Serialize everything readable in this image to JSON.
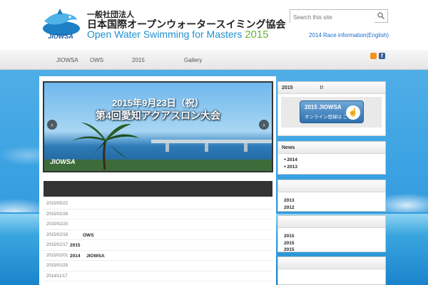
{
  "header": {
    "org_small": "一般社団法人",
    "org_title": "日本国際オープンウォータースイミング協会",
    "org_sub": "Open Water Swimming for Masters",
    "org_year": "2015",
    "logo_text": "JIOWSA"
  },
  "search": {
    "placeholder": "Search this site"
  },
  "race_link": "2014 Race information(English)",
  "nav": {
    "items": [
      "JIOWSA",
      "OWS",
      "2015",
      "Gallery"
    ]
  },
  "slider": {
    "date": "2015年9月23日（祝）",
    "title": "第4回愛知アクアスロン大会",
    "logo": "JIOWSA"
  },
  "news_list": [
    {
      "date": "2015/05/22",
      "tag": ""
    },
    {
      "date": "2015/02/28",
      "tag": ""
    },
    {
      "date": "2015/02/20",
      "tag": ""
    },
    {
      "date": "2015/02/18",
      "tag": "OWS"
    },
    {
      "date": "2015/02/17",
      "tag": "2015"
    },
    {
      "date": "2015/02/01",
      "tag": "2014",
      "tag2": "JIOWSA"
    },
    {
      "date": "2015/01/29",
      "tag": ""
    },
    {
      "date": "2014/11/17",
      "tag": ""
    }
  ],
  "sidebar": {
    "widget1_title": "2015",
    "widget1_title_suffix": "!!",
    "register_line1": "2015 JIOWSA",
    "register_line2": "オンライン登録は こちら",
    "widget2_title": "News",
    "widget2_items": [
      "2014",
      "2013"
    ],
    "widget3_items": [
      "2013",
      "2012"
    ],
    "widget4_items": [
      "2015",
      "2015",
      "2015"
    ]
  },
  "colors": {
    "brand_blue": "#1f8fd0",
    "brand_green": "#68b231",
    "link": "#1a6bc6"
  }
}
